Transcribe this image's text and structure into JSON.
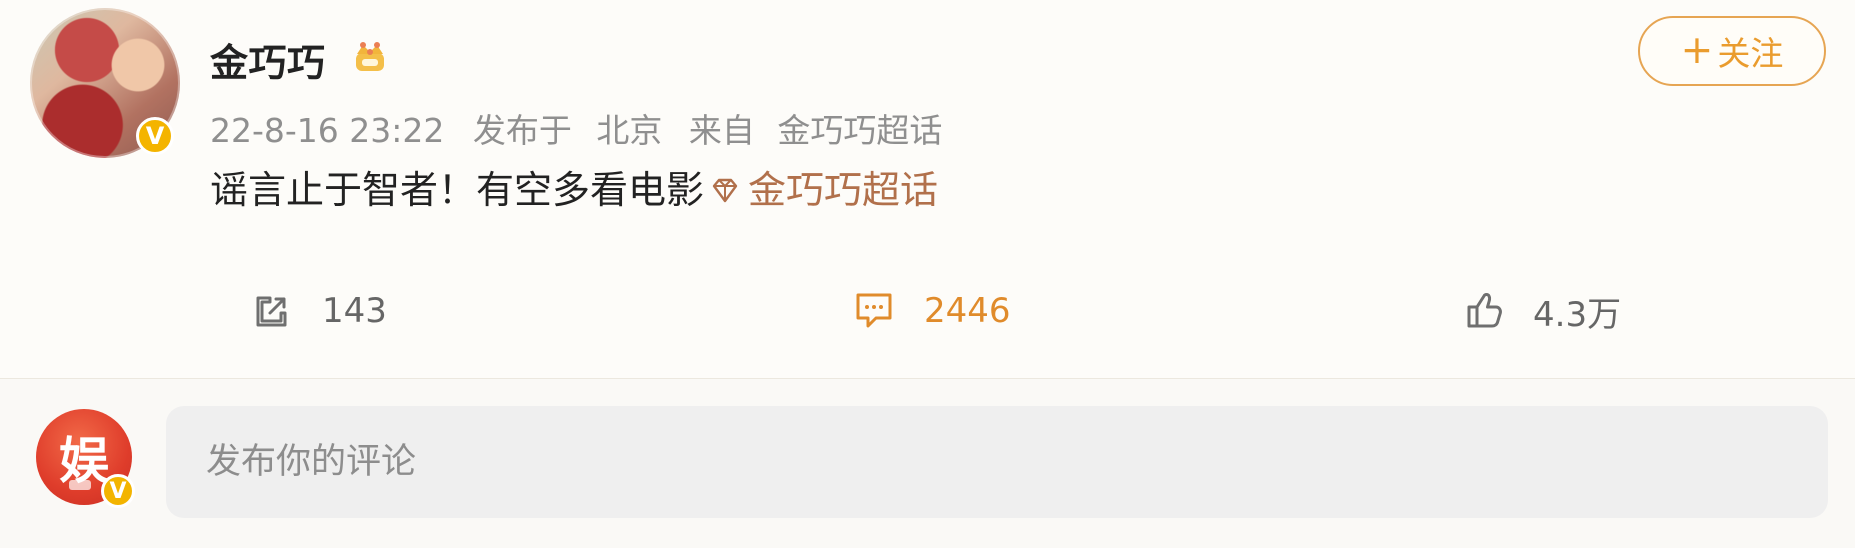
{
  "post": {
    "author": {
      "name": "金巧巧",
      "avatar_badge": "V",
      "icon": "crown-icon"
    },
    "follow_button": {
      "plus": "+",
      "label": "关注"
    },
    "meta": {
      "time": "22-8-16 23:22",
      "published_label": "发布于",
      "location": "北京",
      "from_label": "来自",
      "source": "金巧巧超话"
    },
    "content": {
      "text": "谣言止于智者！有空多看电影",
      "topic_icon": "diamond-icon",
      "topic_label": "金巧巧超话"
    },
    "actions": {
      "share": {
        "icon": "share-icon",
        "count": "143"
      },
      "comment": {
        "icon": "comment-icon",
        "count": "2446"
      },
      "like": {
        "icon": "thumb-up-icon",
        "count": "4.3万"
      }
    }
  },
  "comment_box": {
    "avatar_badge": "V",
    "avatar_text": "娱",
    "placeholder": "发布你的评论"
  },
  "colors": {
    "accent": "#e6a553",
    "topic": "#b1704b",
    "verified": "#f4b400",
    "comment_active": "#e08b2b"
  }
}
